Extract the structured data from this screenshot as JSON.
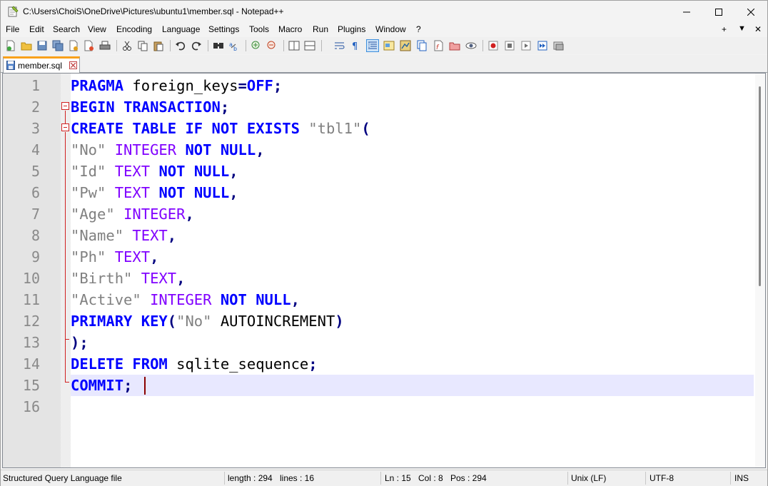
{
  "window": {
    "title": "C:\\Users\\ChoiS\\OneDrive\\Pictures\\ubuntu1\\member.sql - Notepad++"
  },
  "menu": {
    "items": [
      "File",
      "Edit",
      "Search",
      "View",
      "Encoding",
      "Language",
      "Settings",
      "Tools",
      "Macro",
      "Run",
      "Plugins",
      "Window",
      "?"
    ],
    "right_plus": "+",
    "right_arrow": "▼",
    "right_close": "✕"
  },
  "toolbar": {
    "icons": [
      "new-file-icon",
      "open-file-icon",
      "save-icon",
      "save-all-icon",
      "close-icon",
      "close-all-icon",
      "print-icon",
      "cut-icon",
      "copy-icon",
      "paste-icon",
      "undo-icon",
      "redo-icon",
      "find-icon",
      "replace-icon",
      "zoom-in-icon",
      "zoom-out-icon",
      "sync-vertical-icon",
      "sync-horizontal-icon",
      "word-wrap-icon",
      "show-all-chars-icon",
      "indent-guide-icon",
      "udl-icon",
      "doc-map-icon",
      "doc-list-icon",
      "function-list-icon",
      "folder-workspace-icon",
      "monitor-icon",
      "record-macro-icon",
      "stop-macro-icon",
      "play-macro-icon",
      "run-multiple-icon",
      "save-macro-icon"
    ]
  },
  "tabs": [
    {
      "label": "member.sql",
      "active": true
    }
  ],
  "editor": {
    "line_numbers": [
      "1",
      "2",
      "3",
      "4",
      "5",
      "6",
      "7",
      "8",
      "9",
      "10",
      "11",
      "12",
      "13",
      "14",
      "15",
      "16"
    ],
    "lines": [
      [
        {
          "t": "PRAGMA",
          "c": "kw"
        },
        {
          "t": " foreign_keys",
          "c": "id"
        },
        {
          "t": "=",
          "c": "op"
        },
        {
          "t": "OFF",
          "c": "kw"
        },
        {
          "t": ";",
          "c": "op"
        }
      ],
      [
        {
          "t": "BEGIN",
          "c": "kw"
        },
        {
          "t": " ",
          "c": "id"
        },
        {
          "t": "TRANSACTION",
          "c": "kw"
        },
        {
          "t": ";",
          "c": "op"
        }
      ],
      [
        {
          "t": "CREATE",
          "c": "kw"
        },
        {
          "t": " ",
          "c": "id"
        },
        {
          "t": "TABLE",
          "c": "kw"
        },
        {
          "t": " ",
          "c": "id"
        },
        {
          "t": "IF",
          "c": "kw"
        },
        {
          "t": " ",
          "c": "id"
        },
        {
          "t": "NOT",
          "c": "kw"
        },
        {
          "t": " ",
          "c": "id"
        },
        {
          "t": "EXISTS",
          "c": "kw"
        },
        {
          "t": " ",
          "c": "id"
        },
        {
          "t": "\"tbl1\"",
          "c": "str"
        },
        {
          "t": "(",
          "c": "op"
        }
      ],
      [
        {
          "t": "\"No\"",
          "c": "str"
        },
        {
          "t": " ",
          "c": "id"
        },
        {
          "t": "INTEGER",
          "c": "ty"
        },
        {
          "t": " ",
          "c": "id"
        },
        {
          "t": "NOT",
          "c": "kw"
        },
        {
          "t": " ",
          "c": "id"
        },
        {
          "t": "NULL",
          "c": "kw"
        },
        {
          "t": ",",
          "c": "op"
        }
      ],
      [
        {
          "t": "\"Id\"",
          "c": "str"
        },
        {
          "t": " ",
          "c": "id"
        },
        {
          "t": "TEXT",
          "c": "ty"
        },
        {
          "t": " ",
          "c": "id"
        },
        {
          "t": "NOT",
          "c": "kw"
        },
        {
          "t": " ",
          "c": "id"
        },
        {
          "t": "NULL",
          "c": "kw"
        },
        {
          "t": ",",
          "c": "op"
        }
      ],
      [
        {
          "t": "\"Pw\"",
          "c": "str"
        },
        {
          "t": " ",
          "c": "id"
        },
        {
          "t": "TEXT",
          "c": "ty"
        },
        {
          "t": " ",
          "c": "id"
        },
        {
          "t": "NOT",
          "c": "kw"
        },
        {
          "t": " ",
          "c": "id"
        },
        {
          "t": "NULL",
          "c": "kw"
        },
        {
          "t": ",",
          "c": "op"
        }
      ],
      [
        {
          "t": "\"Age\"",
          "c": "str"
        },
        {
          "t": " ",
          "c": "id"
        },
        {
          "t": "INTEGER",
          "c": "ty"
        },
        {
          "t": ",",
          "c": "op"
        }
      ],
      [
        {
          "t": "\"Name\"",
          "c": "str"
        },
        {
          "t": " ",
          "c": "id"
        },
        {
          "t": "TEXT",
          "c": "ty"
        },
        {
          "t": ",",
          "c": "op"
        }
      ],
      [
        {
          "t": "\"Ph\"",
          "c": "str"
        },
        {
          "t": " ",
          "c": "id"
        },
        {
          "t": "TEXT",
          "c": "ty"
        },
        {
          "t": ",",
          "c": "op"
        }
      ],
      [
        {
          "t": "\"Birth\"",
          "c": "str"
        },
        {
          "t": " ",
          "c": "id"
        },
        {
          "t": "TEXT",
          "c": "ty"
        },
        {
          "t": ",",
          "c": "op"
        }
      ],
      [
        {
          "t": "\"Active\"",
          "c": "str"
        },
        {
          "t": " ",
          "c": "id"
        },
        {
          "t": "INTEGER",
          "c": "ty"
        },
        {
          "t": " ",
          "c": "id"
        },
        {
          "t": "NOT",
          "c": "kw"
        },
        {
          "t": " ",
          "c": "id"
        },
        {
          "t": "NULL",
          "c": "kw"
        },
        {
          "t": ",",
          "c": "op"
        }
      ],
      [
        {
          "t": "PRIMARY",
          "c": "kw"
        },
        {
          "t": " ",
          "c": "id"
        },
        {
          "t": "KEY",
          "c": "kw"
        },
        {
          "t": "(",
          "c": "op"
        },
        {
          "t": "\"No\"",
          "c": "str"
        },
        {
          "t": " AUTOINCREMENT",
          "c": "id"
        },
        {
          "t": ")",
          "c": "op"
        }
      ],
      [
        {
          "t": ");",
          "c": "op"
        }
      ],
      [
        {
          "t": "DELETE",
          "c": "kw"
        },
        {
          "t": " ",
          "c": "id"
        },
        {
          "t": "FROM",
          "c": "kw"
        },
        {
          "t": " sqlite_sequence",
          "c": "id"
        },
        {
          "t": ";",
          "c": "op"
        }
      ],
      [
        {
          "t": "COMMIT",
          "c": "kw"
        },
        {
          "t": ";",
          "c": "op"
        }
      ],
      []
    ],
    "colors": {
      "keyword": "#0000ff",
      "type": "#8000ff",
      "string": "#808080",
      "operator": "#000080",
      "current_line": "#e8e8ff",
      "fold_marker": "#d02020"
    }
  },
  "status": {
    "language": "Structured Query Language file",
    "length": "length : 294",
    "lines": "lines : 16",
    "ln": "Ln : 15",
    "col": "Col : 8",
    "pos": "Pos : 294",
    "eol": "Unix (LF)",
    "encoding": "UTF-8",
    "mode": "INS"
  }
}
